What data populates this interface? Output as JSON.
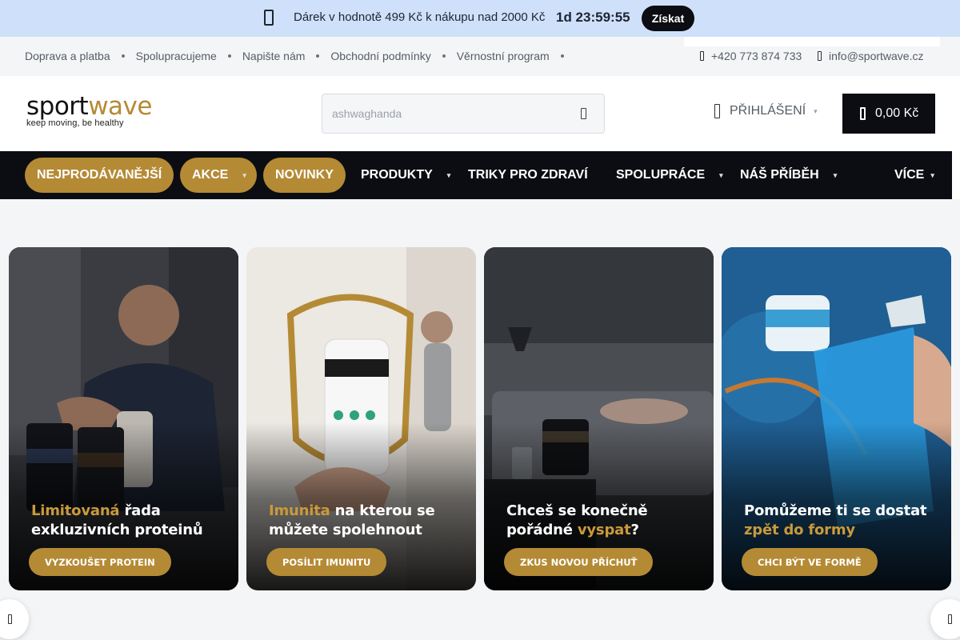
{
  "promo": {
    "message": "Dárek v hodnotě 499 Kč k nákupu nad 2000 Kč",
    "countdown": "1d 23:59:55",
    "cta": "Získat",
    "icon": "gift-icon"
  },
  "toplinks": {
    "items": [
      "Doprava a platba",
      "Spolupracujeme",
      "Napište nám",
      "Obchodní podmínky",
      "Věrnostní program"
    ],
    "phone": "+420 773 874 733",
    "email": "info@sportwave.cz"
  },
  "header": {
    "logo_part1": "sport",
    "logo_part2": "wave",
    "logo_tagline": "keep moving, be healthy",
    "search_placeholder": "ashwaghanda",
    "login_label": "PŘIHLÁŠENÍ",
    "cart_total": "0,00 Kč"
  },
  "nav": {
    "items": [
      {
        "label": "NEJPRODÁVANĚJŠÍ"
      },
      {
        "label": "AKCE"
      },
      {
        "label": "NOVINKY"
      },
      {
        "label": "PRODUKTY"
      },
      {
        "label": "TRIKY PRO ZDRAVÍ"
      },
      {
        "label": "SPOLUPRÁCE"
      },
      {
        "label": "NÁŠ PŘÍBĚH"
      },
      {
        "label": "VÍCE"
      }
    ]
  },
  "banners": [
    {
      "title_accent": "Limitovaná",
      "title_rest": " řada exkluzivních proteinů",
      "cta": "VYZKOUŠET PROTEIN"
    },
    {
      "title_accent": "Imunita",
      "title_rest": " na kterou se můžete spolehnout",
      "cta": "POSÍLIT IMUNITU"
    },
    {
      "title_pre": "Chceš se konečně pořádné ",
      "title_accent": "vyspat",
      "title_post": "?",
      "cta": "ZKUS NOVOU PŘÍCHUŤ"
    },
    {
      "title_pre": "Pomůžeme ti se dostat ",
      "title_accent": "zpět do formy",
      "cta": "CHCI BÝT VE FORMĚ"
    }
  ],
  "colors": {
    "accent": "#b58a35",
    "dark": "#0b0d12",
    "promo_bg": "#cfe0fb"
  }
}
